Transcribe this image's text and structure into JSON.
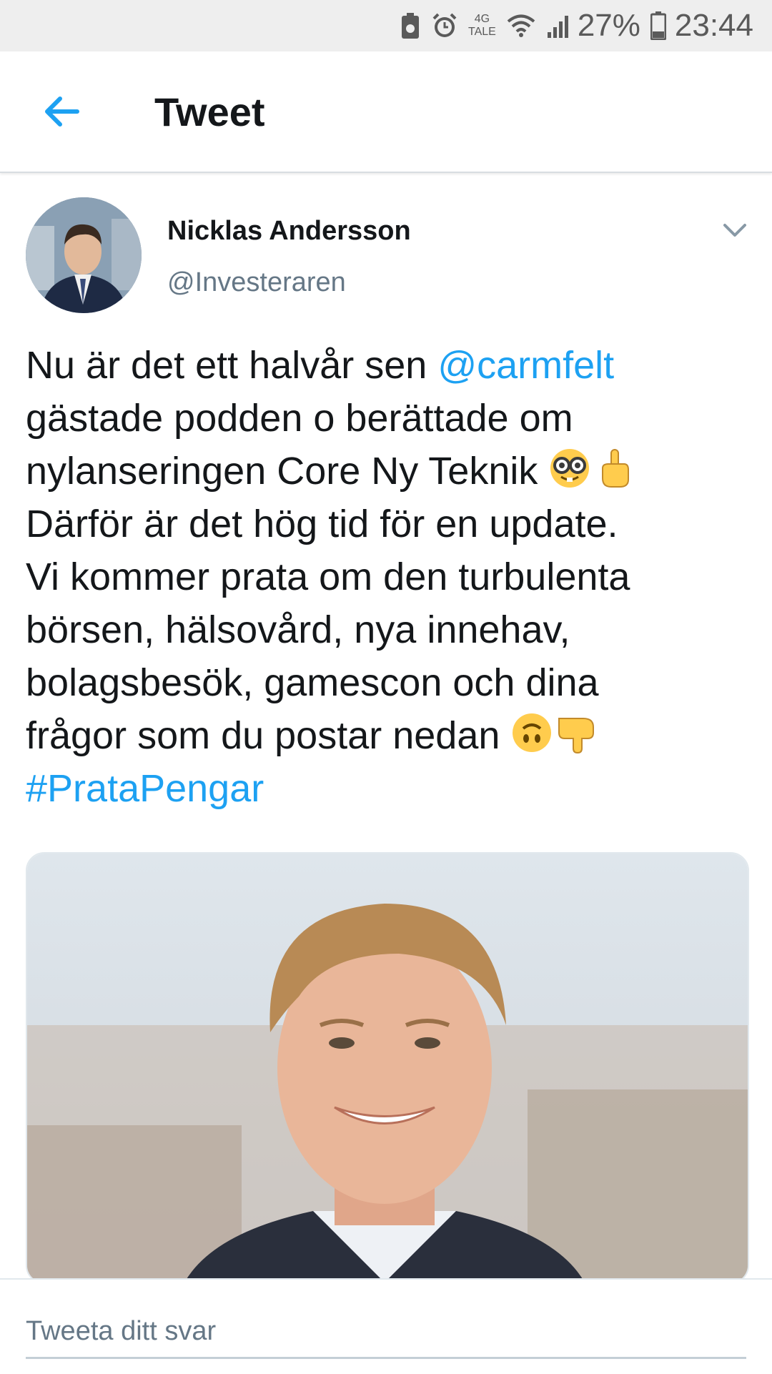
{
  "status_bar": {
    "network": "4G",
    "network_sub": "TALE",
    "battery": "27%",
    "time": "23:44"
  },
  "header": {
    "title": "Tweet"
  },
  "tweet": {
    "author_name": "Nicklas Andersson",
    "author_handle": "@Investeraren",
    "text_part1": "Nu är det ett halvår sen ",
    "mention": "@carmfelt",
    "text_part2": "\ngästade podden o berättade om\nnylanseringen Core Ny Teknik ",
    "text_part3": "\nDärför är det hög tid för en update.\nVi kommer prata om den turbulenta\nbörsen, hälsovård, nya innehav,\nbolagsbesök, gamescon och dina\nfrågor som du postar nedan ",
    "hashtag": "#PrataPengar"
  },
  "reply": {
    "placeholder": "Tweeta ditt svar"
  },
  "colors": {
    "accent": "#1da1f2",
    "text": "#14171a",
    "secondary": "#657786"
  }
}
